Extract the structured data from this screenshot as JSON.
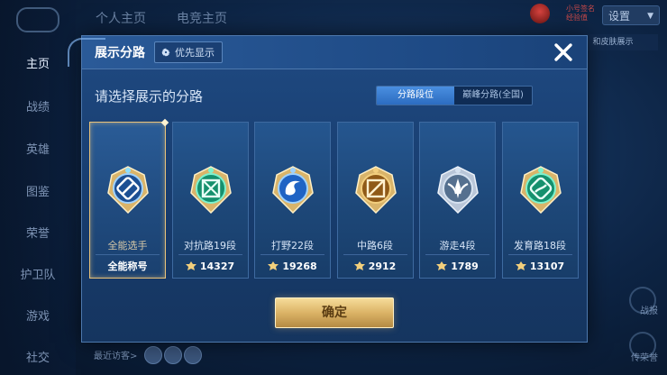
{
  "background": {
    "sidebar": [
      "主页",
      "战绩",
      "英雄",
      "图鉴",
      "荣誉",
      "护卫队",
      "游戏",
      "社交"
    ],
    "top_tabs": [
      "个人主页",
      "电竞主页"
    ],
    "settings_label": "设置",
    "avatar_text": [
      "小号签名",
      "经验值"
    ],
    "right_button": "和皮肤展示",
    "right_labels": [
      "战报",
      "传荣誉"
    ],
    "recent_visitors": "最近访客>"
  },
  "modal": {
    "title": "展示分路",
    "priority_label": "优先显示",
    "subtitle": "请选择展示的分路",
    "toggle": [
      "分路段位",
      "巅峰分路(全国)"
    ],
    "toggle_active": 0,
    "confirm_label": "确定"
  },
  "cards": [
    {
      "name": "全能选手",
      "bottom": "全能称号",
      "points": null,
      "selected": true,
      "color": "#4a90d9"
    },
    {
      "name": "对抗路19段",
      "bottom": "14327",
      "points": 14327,
      "selected": false,
      "color": "#2fc39a"
    },
    {
      "name": "打野22段",
      "bottom": "19268",
      "points": 19268,
      "selected": false,
      "color": "#3c86e6"
    },
    {
      "name": "中路6段",
      "bottom": "2912",
      "points": 2912,
      "selected": false,
      "color": "#c48a2e"
    },
    {
      "name": "游走4段",
      "bottom": "1789",
      "points": 1789,
      "selected": false,
      "color": "#8fa6c4"
    },
    {
      "name": "发育路18段",
      "bottom": "13107",
      "points": 13107,
      "selected": false,
      "color": "#2fc39a"
    }
  ]
}
